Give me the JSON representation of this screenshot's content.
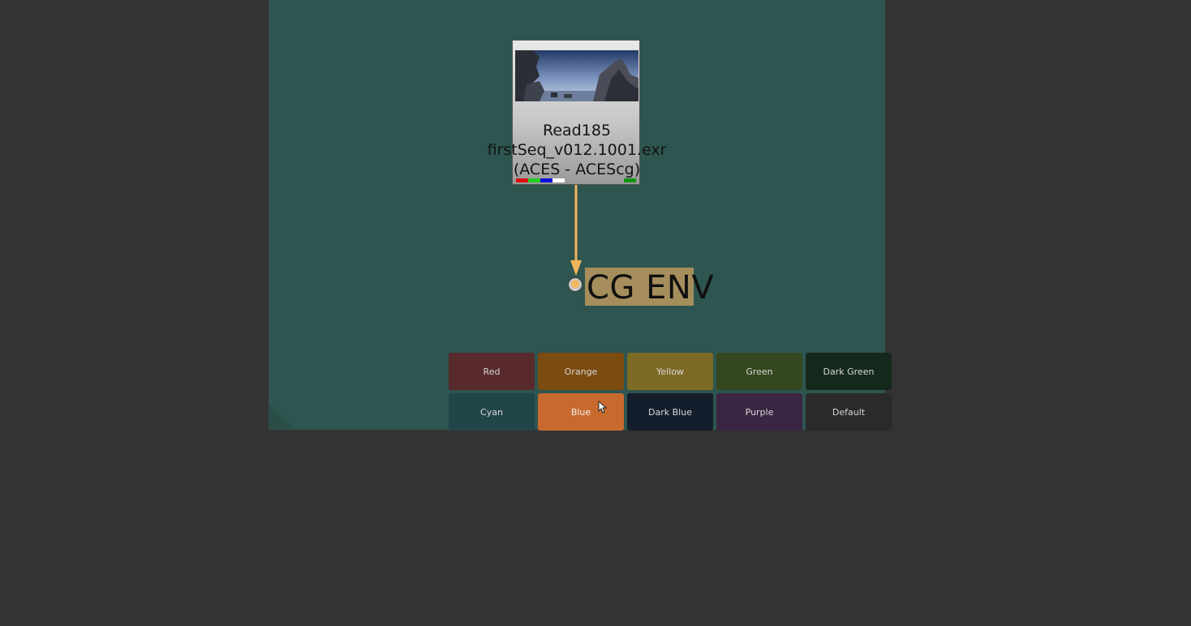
{
  "read_node": {
    "title": "Read185",
    "file": "firstSeq_v012.1001.exr",
    "colorspace": "(ACES - ACEScg)",
    "channels": [
      "#e01010",
      "#20d020",
      "#1010e0",
      "#ffffff"
    ]
  },
  "backdrop": {
    "label": "CG ENV",
    "color": "#a58e5c"
  },
  "palette": [
    {
      "label": "Red",
      "color": "#582a2c"
    },
    {
      "label": "Orange",
      "color": "#7c4b10"
    },
    {
      "label": "Yellow",
      "color": "#7d6b25"
    },
    {
      "label": "Green",
      "color": "#34471f"
    },
    {
      "label": "Dark Green",
      "color": "#15281c"
    },
    {
      "label": "Cyan",
      "color": "#22454a"
    },
    {
      "label": "Blue",
      "color": "#c86a2e",
      "highlighted": true
    },
    {
      "label": "Dark Blue",
      "color": "#141d2c"
    },
    {
      "label": "Purple",
      "color": "#3a2642"
    },
    {
      "label": "Default",
      "color": "#2a2a2a"
    }
  ],
  "colors": {
    "canvas": "#2e5550",
    "edge": "#f2b55a",
    "background": "#333333"
  }
}
